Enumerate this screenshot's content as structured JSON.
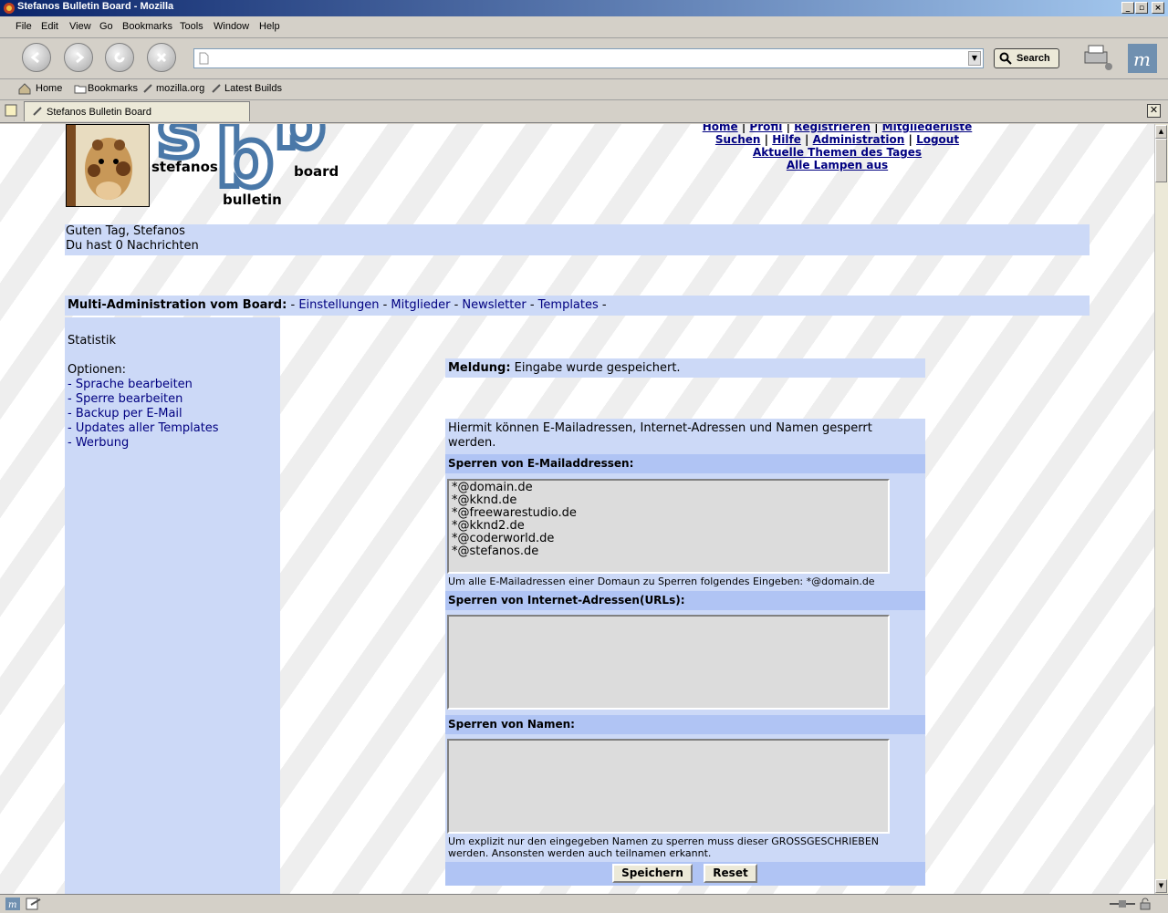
{
  "window": {
    "title": "Stefanos Bulletin Board - Mozilla"
  },
  "menu": {
    "items": [
      "File",
      "Edit",
      "View",
      "Go",
      "Bookmarks",
      "Tools",
      "Window",
      "Help"
    ]
  },
  "toolbar": {
    "url_value": "",
    "search_label": "Search"
  },
  "bookmarks": {
    "items": [
      "Home",
      "Bookmarks",
      "mozilla.org",
      "Latest Builds"
    ]
  },
  "tab": {
    "title": "Stefanos Bulletin Board"
  },
  "logo": {
    "letters": "sbb",
    "word1": "stefanos",
    "word2": "board",
    "word3": "bulletin"
  },
  "topnav": {
    "row1": [
      "Home",
      "Profil",
      "Registrieren",
      "Mitgliederliste"
    ],
    "row2": [
      "Suchen",
      "Hilfe",
      "Administration",
      "Logout"
    ],
    "row3": "Aktuelle Themen des Tages",
    "row4": "Alle Lampen aus",
    "sep": "|"
  },
  "greeting": {
    "line1": "Guten Tag, Stefanos",
    "line2": "Du hast 0 Nachrichten"
  },
  "admin": {
    "label": "Multi-Administration vom Board:",
    "links": [
      "Einstellungen",
      "Mitglieder",
      "Newsletter",
      "Templates"
    ],
    "dash": "-"
  },
  "sidebar": {
    "statistik": "Statistik",
    "options_label": "Optionen:",
    "links": [
      "- Sprache bearbeiten",
      "- Sperre bearbeiten",
      "- Backup per E-Mail",
      "- Updates aller Templates",
      "- Werbung"
    ]
  },
  "message": {
    "label": "Meldung:",
    "text": "Eingabe wurde gespeichert."
  },
  "form": {
    "intro": "Hiermit können E-Mailadressen, Internet-Adressen und Namen gesperrt werden.",
    "email_header": "Sperren von E-Mailaddressen:",
    "email_value": "*@domain.de\n*@kknd.de\n*@freewarestudio.de\n*@kknd2.de\n*@coderworld.de\n*@stefanos.de",
    "email_note": "Um alle E-Mailadressen einer Domaun zu Sperren folgendes Eingeben: *@domain.de",
    "url_header": "Sperren von Internet-Adressen(URLs):",
    "url_value": "",
    "name_header": "Sperren von Namen:",
    "name_value": "",
    "name_note": "Um explizit nur den eingegeben Namen zu sperren muss dieser GROSSGESCHRIEBEN werden. Ansonsten werden auch teilnamen erkannt.",
    "save_label": "Speichern",
    "reset_label": "Reset"
  },
  "colors": {
    "panel": "#ccd9f7",
    "header": "#b0c4f4",
    "link": "#000080",
    "titlebar": "#0a246a"
  }
}
